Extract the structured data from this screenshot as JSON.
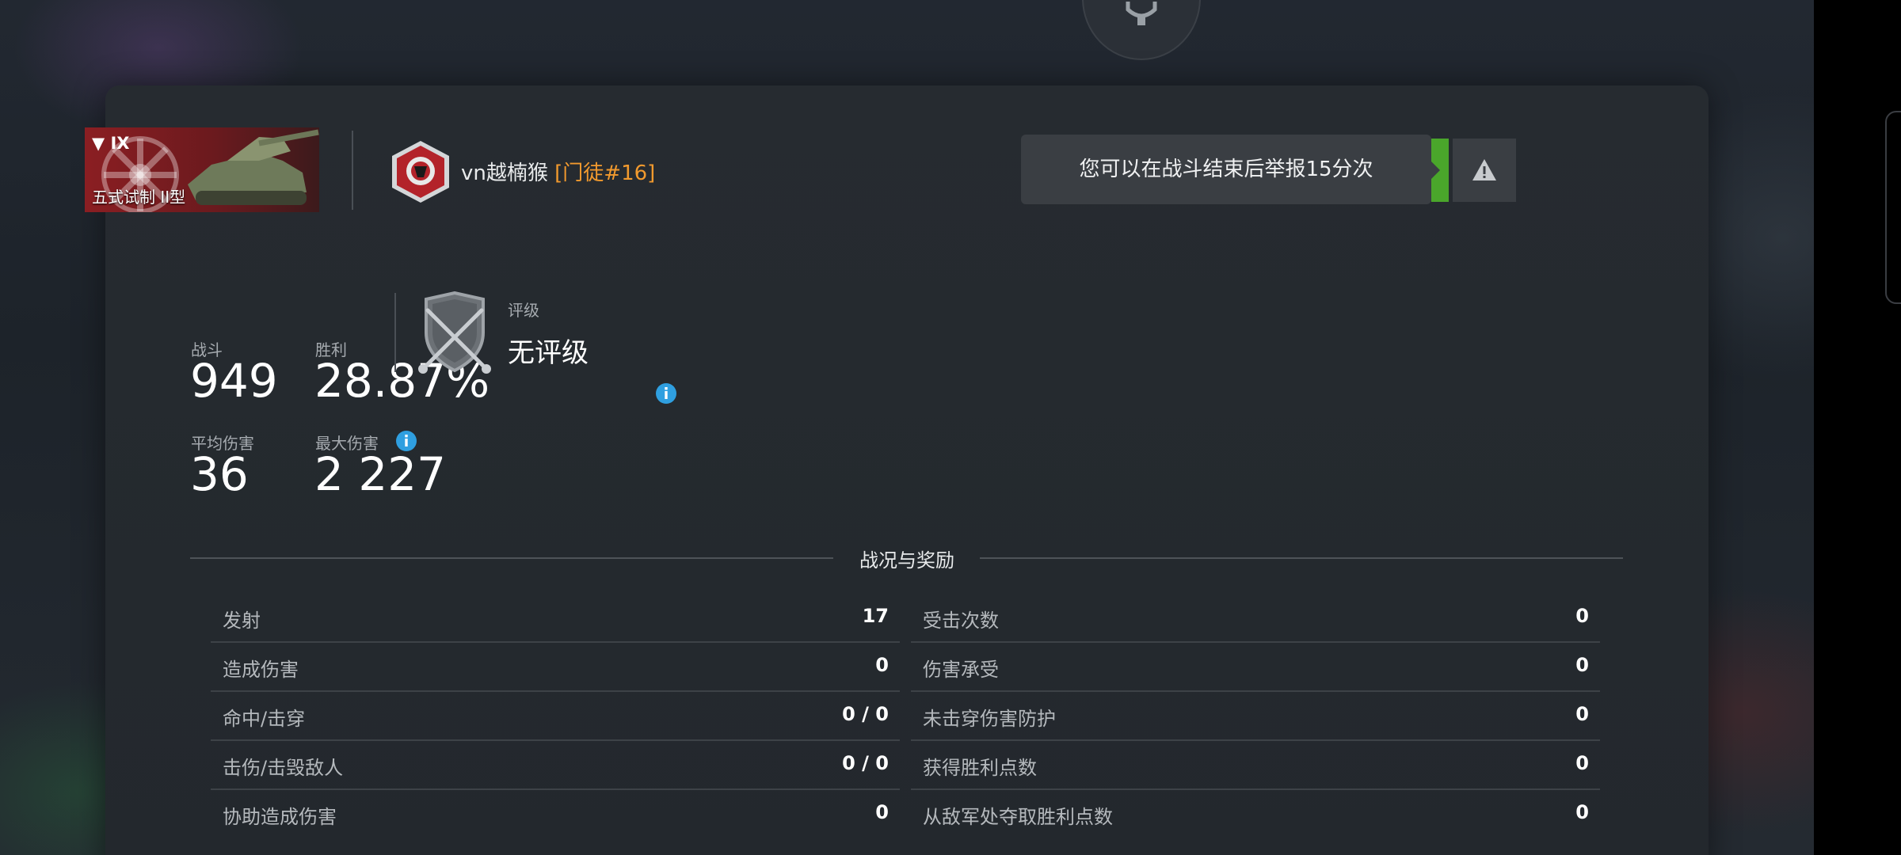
{
  "header": {
    "vehicle": {
      "tier": "▼ IX",
      "name": "五式试制 II型"
    },
    "player": {
      "name": "vn越楠猴",
      "clan": "[门徒#16]"
    },
    "report": {
      "message": "您可以在战斗结束后举报15分次",
      "icon": "warning-icon"
    }
  },
  "stats": {
    "battles": {
      "label": "战斗",
      "value": "949"
    },
    "wins": {
      "label": "胜利",
      "value": "28.87%"
    },
    "avg_damage": {
      "label": "平均伤害",
      "value": "36"
    },
    "max_damage": {
      "label": "最大伤害",
      "value": "2 227"
    },
    "rating": {
      "label": "评级",
      "value": "无评级"
    }
  },
  "section": {
    "title": "战况与奖励"
  },
  "left_table": [
    {
      "label": "发射",
      "value": "17"
    },
    {
      "label": "造成伤害",
      "value": "0"
    },
    {
      "label": "命中/击穿",
      "value": "0 / 0"
    },
    {
      "label": "击伤/击毁敌人",
      "value": "0 / 0"
    },
    {
      "label": "协助造成伤害",
      "value": "0"
    }
  ],
  "right_table": [
    {
      "label": "受击次数",
      "value": "0"
    },
    {
      "label": "伤害承受",
      "value": "0"
    },
    {
      "label": "未击穿伤害防护",
      "value": "0"
    },
    {
      "label": "获得胜利点数",
      "value": "0"
    },
    {
      "label": "从敌军处夺取胜利点数",
      "value": "0"
    }
  ],
  "colors": {
    "clan": "#f29a2e",
    "report_green": "#4aa62b",
    "info_blue": "#2f9fe0"
  }
}
